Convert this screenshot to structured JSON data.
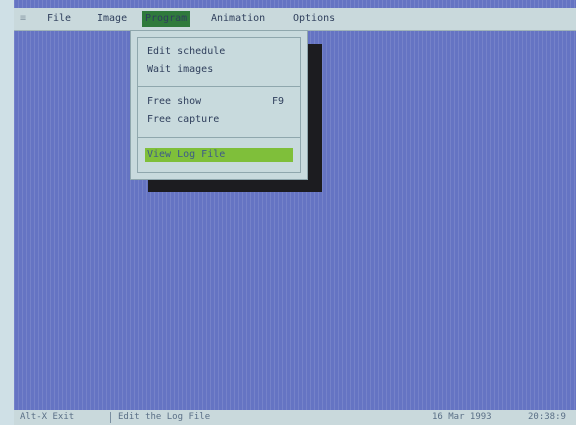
{
  "menubar": {
    "items": [
      {
        "label": "File"
      },
      {
        "label": "Image"
      },
      {
        "label": "Program"
      },
      {
        "label": "Animation"
      },
      {
        "label": "Options"
      }
    ]
  },
  "program_menu": {
    "items": [
      {
        "label": "Edit schedule",
        "shortcut": ""
      },
      {
        "label": "Wait images",
        "shortcut": ""
      },
      {
        "label": "Free show",
        "shortcut": "F9"
      },
      {
        "label": "Free capture",
        "shortcut": ""
      },
      {
        "label": "View Log File",
        "shortcut": "",
        "highlighted": true
      }
    ]
  },
  "statusbar": {
    "exit_hint": "Alt-X Exit",
    "help_text": "Edit the Log File",
    "date": "16 Mar 1993",
    "time": "20:38:9"
  },
  "colors": {
    "desktop": "#6574c3",
    "menubar": "#c9d9dc",
    "active_menu": "#2f7a3c",
    "highlight": "#7fbf3a",
    "hotkey": "#d23a2a"
  }
}
